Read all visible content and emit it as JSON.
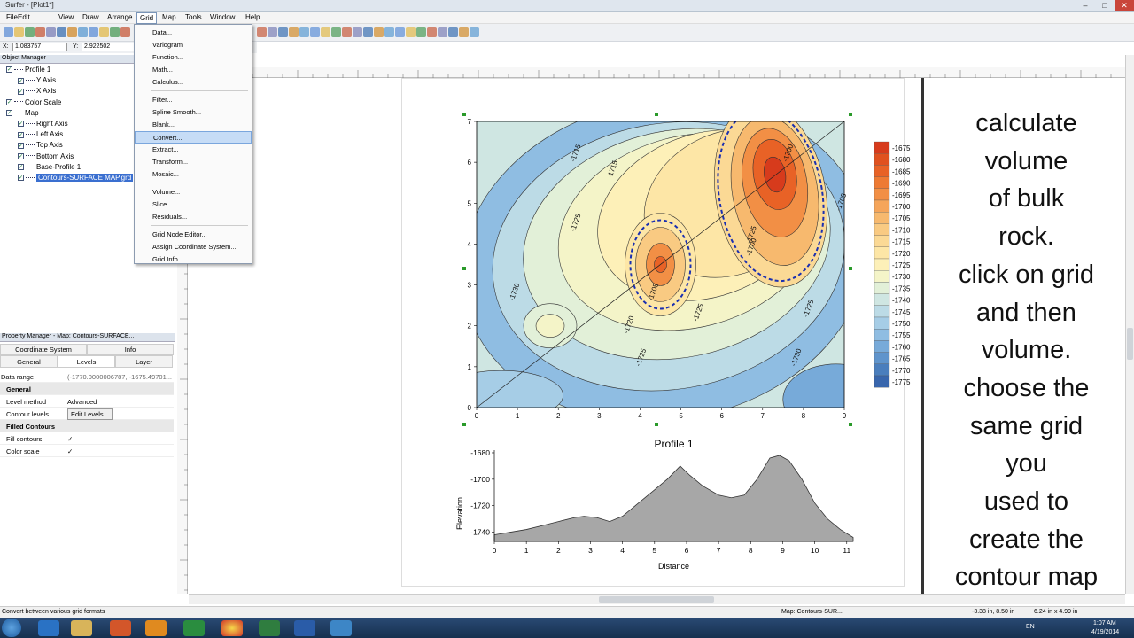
{
  "window": {
    "title": "Surfer - [Plot1*]"
  },
  "menubar": {
    "items": [
      "File",
      "Edit",
      "View",
      "Draw",
      "Arrange",
      "Grid",
      "Map",
      "Tools",
      "Window",
      "Help"
    ],
    "open": "Grid"
  },
  "coords": {
    "x_label": "X:",
    "x_value": "1.083757",
    "y_label": "Y:",
    "y_value": "2.922502"
  },
  "object_manager": {
    "title": "Object Manager",
    "items": [
      {
        "label": "Profile 1",
        "level": 0
      },
      {
        "label": "Y Axis",
        "level": 1
      },
      {
        "label": "X Axis",
        "level": 1
      },
      {
        "label": "Color Scale",
        "level": 0
      },
      {
        "label": "Map",
        "level": 0
      },
      {
        "label": "Right Axis",
        "level": 1
      },
      {
        "label": "Left Axis",
        "level": 1
      },
      {
        "label": "Top Axis",
        "level": 1
      },
      {
        "label": "Bottom Axis",
        "level": 1
      },
      {
        "label": "Base-Profile 1",
        "level": 1
      },
      {
        "label": "Contours-SURFACE MAP.grd",
        "level": 1
      }
    ]
  },
  "property_manager": {
    "title": "Property Manager - Map: Contours-SURFACE...",
    "tabs_row1": [
      "Coordinate System",
      "Info"
    ],
    "tabs_row2": [
      "General",
      "Levels",
      "Layer"
    ],
    "active_tab": "Levels",
    "data_range_label": "Data range",
    "data_range_value": "(-1770.0000006787, -1675.49701...",
    "sections": [
      {
        "title": "General",
        "rows": [
          {
            "k": "Level method",
            "v": "Advanced"
          },
          {
            "k": "Contour levels",
            "v": "Edit Levels..."
          }
        ]
      },
      {
        "title": "Filled Contours",
        "rows": [
          {
            "k": "Fill contours",
            "v": "✓"
          },
          {
            "k": "Color scale",
            "v": "✓"
          }
        ]
      }
    ]
  },
  "grid_menu": {
    "items": [
      "Data...",
      "Variogram",
      "Function...",
      "Math...",
      "Calculus...",
      "-",
      "Filter...",
      "Spline Smooth...",
      "Blank...",
      "Convert...",
      "Extract...",
      "Transform...",
      "Mosaic...",
      "-",
      "Volume...",
      "Slice...",
      "Residuals...",
      "-",
      "Grid Node Editor...",
      "Assign Coordinate System...",
      "Grid Info..."
    ],
    "highlighted": "Convert..."
  },
  "contour_map": {
    "x_ticks": [
      "0",
      "1",
      "2",
      "3",
      "4",
      "5",
      "6",
      "7",
      "8",
      "9"
    ],
    "y_ticks": [
      "0",
      "1",
      "2",
      "3",
      "4",
      "5",
      "6",
      "7"
    ],
    "contour_labels": [
      "-1715",
      "-1715",
      "-1700",
      "-1705",
      "-1725",
      "-1725",
      "-1705",
      "-1720",
      "-1730",
      "-1725",
      "-1700",
      "-1730",
      "-1725",
      "-1725"
    ],
    "colorscale": {
      "labels": [
        "-1675",
        "-1680",
        "-1685",
        "-1690",
        "-1695",
        "-1700",
        "-1705",
        "-1710",
        "-1715",
        "-1720",
        "-1725",
        "-1730",
        "-1735",
        "-1740",
        "-1745",
        "-1750",
        "-1755",
        "-1760",
        "-1765",
        "-1770",
        "-1775"
      ],
      "colors": [
        "#d73b1c",
        "#e0511f",
        "#e86226",
        "#ee7a33",
        "#f28f45",
        "#f5a55a",
        "#f7b96e",
        "#f9ca82",
        "#fbd995",
        "#fde6a6",
        "#fdf0b8",
        "#f4f4c8",
        "#e2f0d8",
        "#cfe6e2",
        "#bcdbe6",
        "#a6cde6",
        "#8fbde2",
        "#77aad9",
        "#5f94cc",
        "#4a7ebd",
        "#3866ad"
      ]
    }
  },
  "chart_data": {
    "type": "area",
    "title": "Profile 1",
    "xlabel": "Distance",
    "ylabel": "Elevation",
    "x_ticks": [
      "0",
      "1",
      "2",
      "3",
      "4",
      "5",
      "6",
      "7",
      "8",
      "9",
      "10",
      "11"
    ],
    "y_ticks": [
      "-1680",
      "-1700",
      "-1720",
      "-1740"
    ],
    "xlim": [
      0,
      11.2
    ],
    "ylim": [
      -1747,
      -1678
    ],
    "series": [
      {
        "x": [
          0,
          0.5,
          1,
          1.5,
          2,
          2.5,
          2.8,
          3.2,
          3.6,
          4,
          4.5,
          5,
          5.4,
          5.8,
          6.1,
          6.5,
          7,
          7.4,
          7.8,
          8.2,
          8.6,
          8.9,
          9.2,
          9.6,
          10,
          10.4,
          10.8,
          11.2
        ],
        "y": [
          -1742,
          -1740,
          -1738,
          -1735,
          -1732,
          -1729,
          -1728,
          -1729,
          -1732,
          -1728,
          -1718,
          -1708,
          -1700,
          -1690,
          -1697,
          -1705,
          -1712,
          -1714,
          -1712,
          -1700,
          -1684,
          -1682,
          -1686,
          -1700,
          -1718,
          -1730,
          -1738,
          -1744
        ]
      }
    ]
  },
  "instruction_text": "calculate\nvolume\nof bulk\nrock.\nclick on grid\nand then\nvolume.\nchoose the\nsame grid\nyou\nused to\ncreate the\ncontour map",
  "statusbar": {
    "left": "Convert between various grid formats",
    "map": "Map: Contours-SUR...",
    "pos": "-3.38 in, 8.50 in",
    "size": "6.24 in x 4.99 in"
  },
  "taskbar": {
    "lang": "EN",
    "time": "1:07 AM",
    "date": "4/19/2014"
  }
}
